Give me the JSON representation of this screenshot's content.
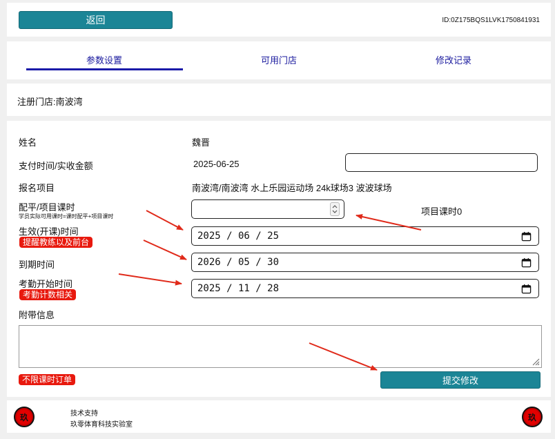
{
  "header": {
    "back_label": "返回",
    "record_id": "ID:0Z175BQS1LVK1750841931"
  },
  "tabs": [
    {
      "label": "参数设置",
      "active": true
    },
    {
      "label": "可用门店",
      "active": false
    },
    {
      "label": "修改记录",
      "active": false
    }
  ],
  "store": {
    "text": "注册门店:南波湾"
  },
  "form": {
    "name_label": "姓名",
    "name_value": "魏晋",
    "payment_label": "支付时间/实收金额",
    "payment_date": "2025-06-25",
    "amount_value": "",
    "project_label": "报名项目",
    "project_value": "南波湾/南波湾 水上乐园运动场 24k球场3 波波球场",
    "hours_label": "配平/项目课时",
    "hours_hint": "学员实际可用课时=课时配平+项目课时",
    "hours_value": "",
    "project_hours_text": "项目课时0",
    "effective_label": "生效(开课)时间",
    "effective_badge": "提醒教练以及前台",
    "effective_value": "2025 / 06 / 25",
    "expire_label": "到期时间",
    "expire_value": "2026 / 05 / 30",
    "attendance_label": "考勤开始时间",
    "attendance_badge": "考勤计数相关",
    "attendance_value": "2025 / 11 / 28",
    "notes_label": "附带信息",
    "notes_value": "",
    "unlimited_badge": "不限课时订单",
    "submit_label": "提交修改"
  },
  "footer": {
    "support_label": "技术支持",
    "lab_name": "玖零体育科技实验室",
    "seal_char": "玖"
  },
  "colors": {
    "teal_button": "#1b8596",
    "tab_text": "#1a1a9e",
    "badge_red": "#e8190e",
    "arrow_red": "#e02a1a"
  }
}
